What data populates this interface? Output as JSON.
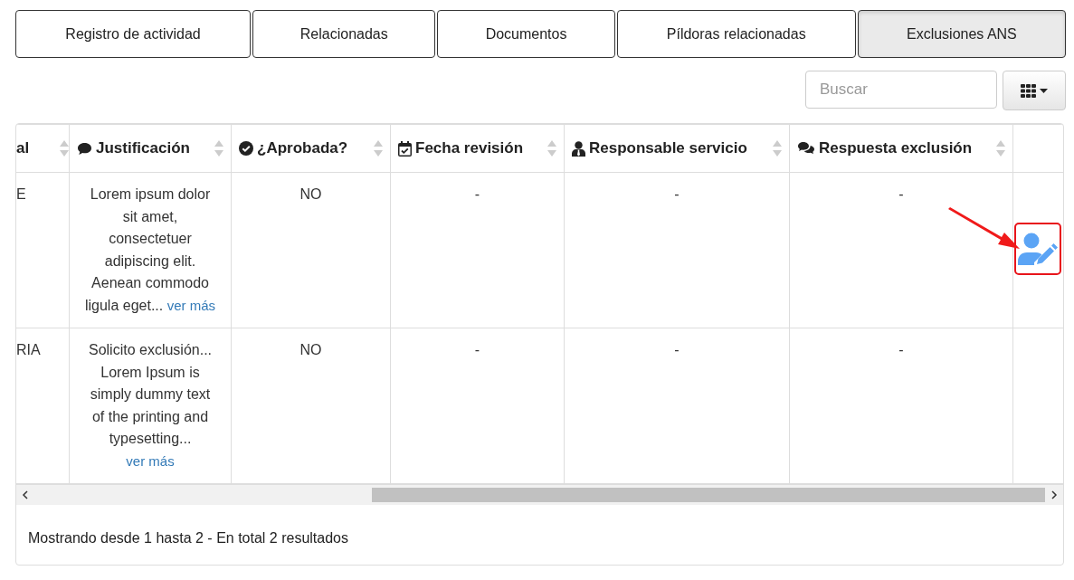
{
  "tabs": [
    {
      "label": "Registro de actividad",
      "selected": false
    },
    {
      "label": "Relacionadas",
      "selected": false
    },
    {
      "label": "Documentos",
      "selected": false
    },
    {
      "label": "Píldoras relacionadas",
      "selected": false
    },
    {
      "label": "Exclusiones ANS",
      "selected": true
    }
  ],
  "search": {
    "placeholder": "Buscar"
  },
  "table": {
    "columns": [
      "al",
      "Justificación",
      "¿Aprobada?",
      "Fecha revisión",
      "Responsable servicio",
      "Respuesta exclusión"
    ],
    "rows": [
      {
        "column_1": "E",
        "justification": "Lorem ipsum dolor sit amet, consectetuer adipiscing elit. Aenean commodo ligula eget...",
        "more_link": "ver más",
        "approved": "NO",
        "review_date": "-",
        "service_owner": "-",
        "response": "-",
        "action": {
          "kind": "edit-user",
          "highlighted": true
        }
      },
      {
        "column_1": "RIA",
        "justification": "Solicito exclusión... Lorem Ipsum is simply dummy text of the printing and typesetting...",
        "more_link": "ver más",
        "approved": "NO",
        "review_date": "-",
        "service_owner": "-",
        "response": "-"
      }
    ]
  },
  "footer": "Mostrando desde 1 hasta 2 - En total 2 resultados"
}
